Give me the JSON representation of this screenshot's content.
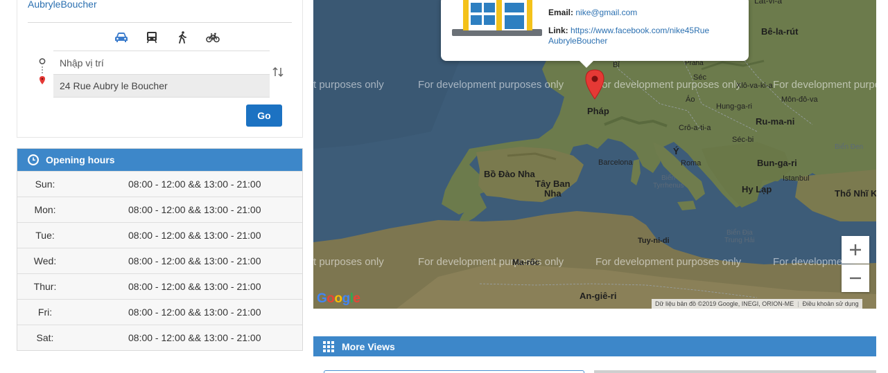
{
  "directions": {
    "place_name": "AubryleBoucher",
    "modes": [
      {
        "icon": "car-icon",
        "active": true
      },
      {
        "icon": "bus-icon",
        "active": false
      },
      {
        "icon": "walk-icon",
        "active": false
      },
      {
        "icon": "bicycle-icon",
        "active": false
      }
    ],
    "origin_placeholder": "Nhập vị trí",
    "destination_value": "24 Rue Aubry le Boucher",
    "go_label": "Go"
  },
  "opening_hours": {
    "title": "Opening hours",
    "rows": [
      {
        "day": "Sun:",
        "time": "08:00 - 12:00 && 13:00 - 21:00"
      },
      {
        "day": "Mon:",
        "time": "08:00 - 12:00 && 13:00 - 21:00"
      },
      {
        "day": "Tue:",
        "time": "08:00 - 12:00 && 13:00 - 21:00"
      },
      {
        "day": "Wed:",
        "time": "08:00 - 12:00 && 13:00 - 21:00"
      },
      {
        "day": "Thur:",
        "time": "08:00 - 12:00 && 13:00 - 21:00"
      },
      {
        "day": "Fri:",
        "time": "08:00 - 12:00 && 13:00 - 21:00"
      },
      {
        "day": "Sat:",
        "time": "08:00 - 12:00 && 13:00 - 21:00"
      }
    ]
  },
  "map": {
    "info": {
      "email_label": "Email:",
      "email_value": "nike@gmail.com",
      "link_label": "Link:",
      "link_value_1": "https://www.facebook.com/nike45Rue",
      "link_value_2": "AubryleBoucher"
    },
    "labels": {
      "latvia": "Lát-vi-a",
      "belarus": "Bê-la-rút",
      "bi": "Bỉ",
      "prague": "Praha",
      "czech": "Séc",
      "slovakia": "Xlô-va-ki-a",
      "moldova": "Môn-đô-va",
      "austria": "Áo",
      "hungary": "Hung-ga-ri",
      "france": "Pháp",
      "romania": "Ru-ma-ni",
      "croatia": "Crô-a-ti-a",
      "serbia": "Séc-bi",
      "black_sea": "Biển Đen",
      "italy": "Ý",
      "barcelona": "Barcelona",
      "rome": "Roma",
      "bulgaria": "Bun-ga-ri",
      "portugal": "Bồ Đào Nha",
      "spain_1": "Tây Ban",
      "spain_2": "Nha",
      "tyrrhenian_1": "Biển",
      "tyrrhenian_2": "Tyrrhenus",
      "istanbul": "Istanbul",
      "greece": "Hy Lạp",
      "turkey": "Thổ Nhĩ Kỳ",
      "med_1": "Biển Địa",
      "med_2": "Trung Hải",
      "tunisia": "Tuy-ni-di",
      "morocco": "Ma-rốc",
      "algeria": "An-giê-ri"
    },
    "dev_watermark": "For development purposes only",
    "dev_watermark_cut": "t purposes only",
    "dev_watermark_end": "For development purpo",
    "dev_watermark_end2": "For developme",
    "zoom_in": "+",
    "zoom_out": "−",
    "google_logo": "Google",
    "attribution": "Dữ liệu bản đồ ©2019 Google, INEGI, ORION-ME",
    "terms": "Điều khoản sử dụng"
  },
  "more_views": {
    "title": "More Views"
  },
  "colors": {
    "accent": "#3d87c9",
    "button": "#1c72c2",
    "link": "#2a6fb0",
    "sea": "#3d5c78",
    "land": "#6b7a4a",
    "pin": "#e53935"
  }
}
